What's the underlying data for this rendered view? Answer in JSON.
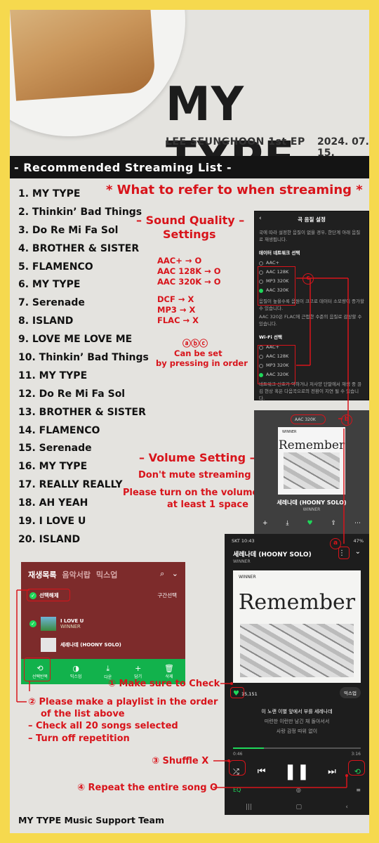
{
  "header": {
    "title": "MY TYPE",
    "subtitle": "LEE SEUNGHOON 1st EP",
    "date": "2024. 07. 15.",
    "banner": "- Recommended Streaming List -"
  },
  "songs": [
    "1. MY TYPE",
    "2. Thinkin’ Bad Things",
    "3. Do Re Mi Fa Sol",
    "4. BROTHER & SISTER",
    "5. FLAMENCO",
    "6. MY TYPE",
    "7. Serenade",
    "8. ISLAND",
    "9. LOVE ME LOVE ME",
    "10. Thinkin’ Bad Things",
    "11. MY TYPE",
    "12. Do Re Mi Fa Sol",
    "13. BROTHER & SISTER",
    "14. FLAMENCO",
    "15. Serenade",
    "16. MY TYPE",
    "17. REALLY REALLY",
    "18. AH YEAH",
    "19. I LOVE U",
    "20. ISLAND"
  ],
  "refer_title": "* What to refer to when streaming *",
  "sound": {
    "heading_line1": "– Sound Quality –",
    "heading_line2": "Settings",
    "allowed": [
      "AAC+ → O",
      "AAC 128K → O",
      "AAC 320K → O"
    ],
    "disallowed": [
      "DCF → X",
      "MP3 → X",
      "FLAC → X"
    ],
    "abc": "ⓐⓑⓒ",
    "abc_note1": "Can be set",
    "abc_note2": "by pressing in order"
  },
  "settings_screen": {
    "title": "곡 음질 설정",
    "note": "국에 따라 설정한 음질이 없을 경우, 한단계 아래 음질로 재생됩니다.",
    "network_heading": "데이터 네트워크 선택",
    "network_options": [
      "AAC+",
      "AAC 128K",
      "MP3 320K",
      "AAC 320K"
    ],
    "network_note1": "음질이 높을수록 음원이 크므로 데이터 소모량이 증가할 수 있습니다.",
    "network_note2": "AAC 320은 FLAC에 근접한 수준의 음질로 감상할 수 있습니다.",
    "wifi_heading": "Wi-Fi 선택",
    "wifi_options": [
      "AAC+",
      "AAC 128K",
      "MP3 320K",
      "AAC 320K"
    ],
    "wifi_note": "네트워크 신호가 약하거나 저사양 단말에서 재생 중 끊김 현상 혹은 다음곡으로의 전환이 지연 될 수 있습니다."
  },
  "volume": {
    "heading": "– Volume Setting –",
    "line1": "Don't mute streaming",
    "line2": "Please turn on the volume",
    "line3": "at least 1 space"
  },
  "player_small": {
    "chip": "AAC 320K",
    "album_label": "WINNER",
    "album_title": "Remember",
    "song": "세레나데 (HOONY SOLO)",
    "artist": "WINNER",
    "likes": "15,151"
  },
  "player_full": {
    "status_left": "SKT 10:43",
    "status_right": "47%",
    "song": "세레나데 (HOONY SOLO)",
    "artist": "WINNER",
    "album_label": "WINNER",
    "album_title": "Remember",
    "likes": "15,151",
    "mix_label": "믹스업",
    "lyric1": "이 노랜 이별 앞에서 부를 세레나데",
    "lyric2": "미련한 이런만 남긴 채 돌아서서",
    "lyric3": "사랑 감정 따위 없이",
    "time_elapsed": "0:46",
    "time_total": "3:16",
    "progress": 0.24
  },
  "playlist_screen": {
    "tabs": [
      "재생목록",
      "음악서랍",
      "믹스업"
    ],
    "select_all": "선택해제",
    "section_select": "구간선택",
    "rows": [
      {
        "title": "I LOVE U",
        "artist": "WINNER"
      },
      {
        "title": "세레나데 (HOONY SOLO)",
        "artist": ""
      }
    ],
    "toolbar": [
      "선택반복",
      "믹스업",
      "다운",
      "담기",
      "삭제"
    ]
  },
  "steps": {
    "s1": "① Make sure to Check",
    "s2_line1": "② Please make a playlist in the order",
    "s2_line2": "of the list above",
    "s2_bullet1": "– Check all 20 songs selected",
    "s2_bullet2": "– Turn off repetition",
    "s3": "③ Shuffle X",
    "s4": "④ Repeat the entire song O"
  },
  "markers": {
    "a": "a",
    "b": "b",
    "c": "c"
  },
  "footer": "MY TYPE Music Support Team",
  "colors": {
    "background": "#f6d94e",
    "accent_red": "#d8141b",
    "melon_green": "#1fd85a"
  }
}
